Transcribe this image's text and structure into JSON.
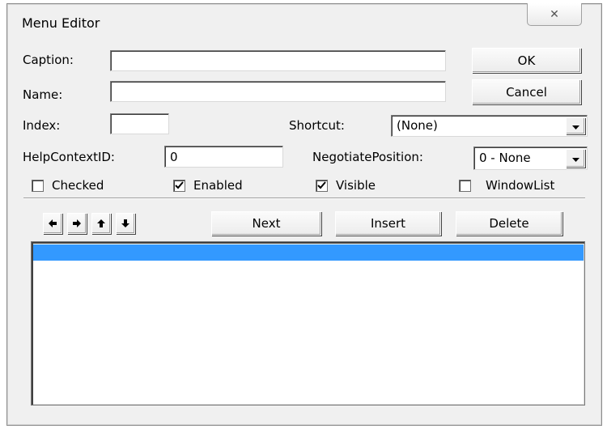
{
  "window": {
    "title": "Menu Editor",
    "close_glyph": "✕"
  },
  "fields": {
    "caption_label": "Caption:",
    "caption_value": "",
    "name_label": "Name:",
    "name_value": "",
    "index_label": "Index:",
    "index_value": "",
    "shortcut_label": "Shortcut:",
    "shortcut_value": "(None)",
    "helpcontext_label": "HelpContextID:",
    "helpcontext_value": "0",
    "negotiate_label": "NegotiatePosition:",
    "negotiate_value": "0 - None"
  },
  "buttons": {
    "ok": "OK",
    "cancel": "Cancel",
    "next": "Next",
    "insert": "Insert",
    "delete": "Delete"
  },
  "checkboxes": [
    {
      "label": "Checked",
      "checked": false
    },
    {
      "label": "Enabled",
      "checked": true
    },
    {
      "label": "Visible",
      "checked": true
    },
    {
      "label": "WindowList",
      "checked": false
    }
  ],
  "arrows": {
    "left": "left-arrow-icon",
    "right": "right-arrow-icon",
    "up": "up-arrow-icon",
    "down": "down-arrow-icon"
  },
  "colors": {
    "selection": "#3399ff",
    "dialog_bg": "#f0f0f0"
  },
  "listbox": {
    "items": [
      ""
    ]
  }
}
